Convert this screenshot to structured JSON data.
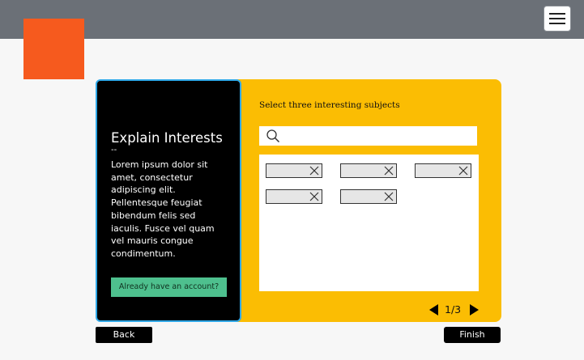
{
  "header": {
    "icons": {
      "menu": "hamburger-menu-icon",
      "logo": "logo-square"
    }
  },
  "colors": {
    "topbar": "#6b7077",
    "logo": "#f65a1e",
    "card": "#fbbd03",
    "panel": "#000000",
    "panel_border": "#2fa8e8",
    "account_button": "#4ec08e"
  },
  "intro": {
    "title": "Explain Interests",
    "dash": "--",
    "body": "Lorem ipsum dolor sit amet, consectetur adipiscing elit. Pellentesque feugiat bibendum felis sed iaculis. Fusce vel quam vel mauris congue condimentum.",
    "account_button": "Already have an account?"
  },
  "selection": {
    "label": "Select three interesting subjects",
    "search_placeholder": "",
    "chips": [
      {
        "label": ""
      },
      {
        "label": ""
      },
      {
        "label": ""
      },
      {
        "label": ""
      },
      {
        "label": ""
      }
    ],
    "icons": {
      "search": "search-icon",
      "remove": "close-icon"
    }
  },
  "pager": {
    "text": "1/3",
    "current": 1,
    "total": 3
  },
  "footer": {
    "back": "Back",
    "finish": "Finish"
  }
}
